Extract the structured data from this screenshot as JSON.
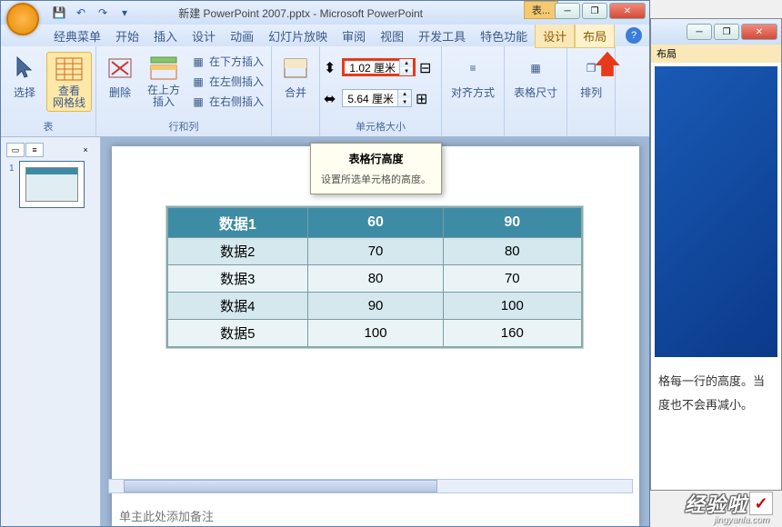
{
  "title": "新建 PowerPoint 2007.pptx - Microsoft PowerPoint",
  "context_tab": "表...",
  "menu": {
    "classic": "经典菜单",
    "start": "开始",
    "insert": "插入",
    "design": "设计",
    "anim": "动画",
    "slideshow": "幻灯片放映",
    "review": "审阅",
    "view": "视图",
    "dev": "开发工具",
    "special": "特色功能",
    "ctx_design": "设计",
    "ctx_layout": "布局"
  },
  "ribbon": {
    "table_group": "表",
    "select": "选择",
    "gridlines": "查看\n网格线",
    "delete": "删除",
    "insert_above": "在上方\n插入",
    "rowscols_group": "行和列",
    "insert_below": "在下方插入",
    "insert_left": "在左侧插入",
    "insert_right": "在右侧插入",
    "merge": "合并",
    "cellsize_group": "单元格大小",
    "height_val": "1.02 厘米",
    "width_val": "5.64 厘米",
    "align": "对齐方式",
    "tablesize": "表格尺寸",
    "arrange": "排列"
  },
  "tooltip": {
    "title": "表格行高度",
    "desc": "设置所选单元格的高度。"
  },
  "table": {
    "header": [
      "数据1",
      "60",
      "90"
    ],
    "rows": [
      [
        "数据2",
        "70",
        "80"
      ],
      [
        "数据3",
        "80",
        "70"
      ],
      [
        "数据4",
        "90",
        "100"
      ],
      [
        "数据5",
        "100",
        "160"
      ]
    ]
  },
  "chart_data": {
    "type": "table",
    "columns": [
      "数据1",
      "60",
      "90"
    ],
    "rows": [
      {
        "label": "数据2",
        "col1": 70,
        "col2": 80
      },
      {
        "label": "数据3",
        "col1": 80,
        "col2": 70
      },
      {
        "label": "数据4",
        "col1": 90,
        "col2": 100
      },
      {
        "label": "数据5",
        "col1": 100,
        "col2": 160
      }
    ]
  },
  "notes": "单主此处添加备注",
  "thumb_num": "1",
  "side": {
    "line1": "格每一行的高度。当",
    "line2": "度也不会再减小。",
    "tab_label": "布局"
  },
  "watermark": {
    "text": "经验啦",
    "url": "jingyanla.com"
  }
}
